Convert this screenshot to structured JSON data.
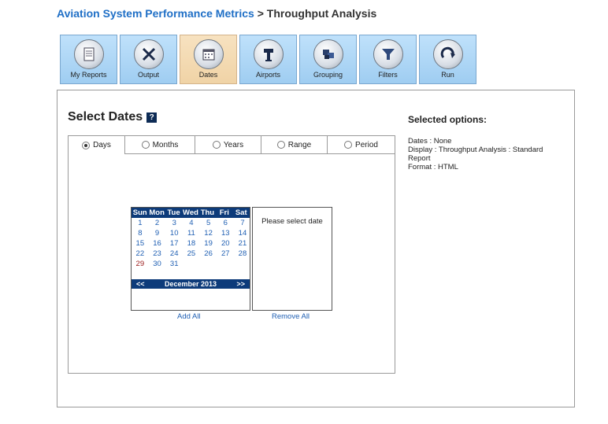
{
  "header": {
    "app_name": "Aviation System Performance Metrics",
    "separator": ">",
    "page_name": "Throughput Analysis"
  },
  "toolbar": [
    {
      "label": "My Reports",
      "icon": "report-icon",
      "active": false
    },
    {
      "label": "Output",
      "icon": "tools-icon",
      "active": false
    },
    {
      "label": "Dates",
      "icon": "calendar-icon",
      "active": true
    },
    {
      "label": "Airports",
      "icon": "tower-icon",
      "active": false
    },
    {
      "label": "Grouping",
      "icon": "grouping-icon",
      "active": false
    },
    {
      "label": "Filters",
      "icon": "filter-icon",
      "active": false
    },
    {
      "label": "Run",
      "icon": "run-icon",
      "active": false
    }
  ],
  "main": {
    "title": "Select Dates",
    "help_icon": "?",
    "tabs": [
      {
        "label": "Days",
        "selected": true
      },
      {
        "label": "Months",
        "selected": false
      },
      {
        "label": "Years",
        "selected": false
      },
      {
        "label": "Range",
        "selected": false
      },
      {
        "label": "Period",
        "selected": false
      }
    ]
  },
  "calendar": {
    "weekdays": [
      "Sun",
      "Mon",
      "Tue",
      "Wed",
      "Thu",
      "Fri",
      "Sat"
    ],
    "days": [
      "1",
      "2",
      "3",
      "4",
      "5",
      "6",
      "7",
      "8",
      "9",
      "10",
      "11",
      "12",
      "13",
      "14",
      "15",
      "16",
      "17",
      "18",
      "19",
      "20",
      "21",
      "22",
      "23",
      "24",
      "25",
      "26",
      "27",
      "28",
      "29",
      "30",
      "31"
    ],
    "highlighted_day": "29",
    "prev": "<<",
    "next": ">>",
    "month_label": "December 2013"
  },
  "selected_dates": {
    "message": "Please select date"
  },
  "actions": {
    "add_all": "Add All",
    "remove_all": "Remove All"
  },
  "options": {
    "title": "Selected options:",
    "dates": "Dates : None",
    "display": "Display : Throughput Analysis : Standard Report",
    "format": "Format : HTML"
  }
}
